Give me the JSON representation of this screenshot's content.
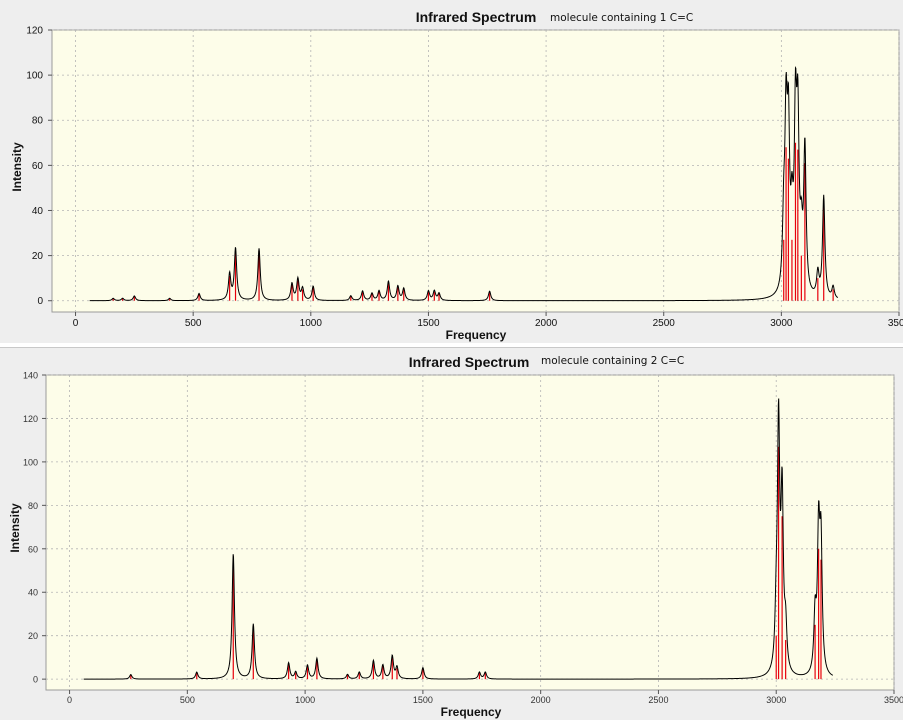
{
  "colors": {
    "plot_background": "#fdfde9",
    "spectrum_line": "#000000",
    "stick_color": "#e8000b",
    "grid_color": "#b4b4b4",
    "panel_background": "#eeeeee"
  },
  "chart_data": [
    {
      "type": "line",
      "title": "Infrared Spectrum",
      "subtitle": "molecule containing 1 C=C",
      "xlabel": "Frequency",
      "ylabel": "Intensity",
      "xlim": [
        -100,
        3500
      ],
      "ylim": [
        -5,
        120
      ],
      "x_ticks": [
        0,
        500,
        1000,
        1500,
        2000,
        2500,
        3000,
        3500
      ],
      "x_tick_labels": [
        "0",
        "500",
        "1000",
        "1500",
        "2000",
        "2500",
        "3000",
        "3500"
      ],
      "y_ticks": [
        0,
        20,
        40,
        60,
        80,
        100,
        120
      ],
      "y_tick_labels": [
        "0",
        "20",
        "40",
        "60",
        "80",
        "100",
        "120"
      ],
      "grid": true,
      "spectrum_range": [
        60,
        3240
      ],
      "peaks": [
        {
          "x": 160,
          "y": 1
        },
        {
          "x": 200,
          "y": 1
        },
        {
          "x": 250,
          "y": 2
        },
        {
          "x": 400,
          "y": 1
        },
        {
          "x": 525,
          "y": 3
        },
        {
          "x": 655,
          "y": 11
        },
        {
          "x": 680,
          "y": 22
        },
        {
          "x": 780,
          "y": 22
        },
        {
          "x": 920,
          "y": 7
        },
        {
          "x": 945,
          "y": 9
        },
        {
          "x": 965,
          "y": 5
        },
        {
          "x": 1010,
          "y": 6
        },
        {
          "x": 1170,
          "y": 2
        },
        {
          "x": 1220,
          "y": 4
        },
        {
          "x": 1260,
          "y": 3
        },
        {
          "x": 1290,
          "y": 4
        },
        {
          "x": 1330,
          "y": 8
        },
        {
          "x": 1370,
          "y": 6
        },
        {
          "x": 1395,
          "y": 5
        },
        {
          "x": 1500,
          "y": 4
        },
        {
          "x": 1525,
          "y": 4
        },
        {
          "x": 1545,
          "y": 3
        },
        {
          "x": 1760,
          "y": 4
        },
        {
          "x": 3010,
          "y": 27
        },
        {
          "x": 3020,
          "y": 68
        },
        {
          "x": 3030,
          "y": 63
        },
        {
          "x": 3045,
          "y": 27
        },
        {
          "x": 3060,
          "y": 70
        },
        {
          "x": 3070,
          "y": 67
        },
        {
          "x": 3085,
          "y": 20
        },
        {
          "x": 3100,
          "y": 61
        },
        {
          "x": 3155,
          "y": 10
        },
        {
          "x": 3180,
          "y": 43
        },
        {
          "x": 3220,
          "y": 5
        }
      ],
      "curve_width": 6
    },
    {
      "type": "line",
      "title": "Infrared Spectrum",
      "subtitle": "molecule containing 2 C=C",
      "xlabel": "Frequency",
      "ylabel": "Intensity",
      "xlim": [
        -100,
        3500
      ],
      "ylim": [
        -5,
        140
      ],
      "x_ticks": [
        0,
        500,
        1000,
        1500,
        2000,
        2500,
        3000,
        3500
      ],
      "x_tick_labels": [
        "0",
        "500",
        "1000",
        "1500",
        "2000",
        "2500",
        "3000",
        "3500"
      ],
      "y_ticks": [
        0,
        20,
        40,
        60,
        80,
        100,
        120,
        140
      ],
      "y_tick_labels": [
        "0",
        "20",
        "40",
        "60",
        "80",
        "100",
        "120",
        "140"
      ],
      "grid": true,
      "spectrum_range": [
        60,
        3240
      ],
      "peaks": [
        {
          "x": 260,
          "y": 2
        },
        {
          "x": 540,
          "y": 3
        },
        {
          "x": 695,
          "y": 55
        },
        {
          "x": 780,
          "y": 24
        },
        {
          "x": 930,
          "y": 7
        },
        {
          "x": 960,
          "y": 3
        },
        {
          "x": 1010,
          "y": 6
        },
        {
          "x": 1050,
          "y": 9
        },
        {
          "x": 1180,
          "y": 2
        },
        {
          "x": 1230,
          "y": 3
        },
        {
          "x": 1290,
          "y": 8
        },
        {
          "x": 1330,
          "y": 6
        },
        {
          "x": 1370,
          "y": 10
        },
        {
          "x": 1390,
          "y": 5
        },
        {
          "x": 1500,
          "y": 5
        },
        {
          "x": 1740,
          "y": 3
        },
        {
          "x": 1765,
          "y": 3
        },
        {
          "x": 3000,
          "y": 20
        },
        {
          "x": 3010,
          "y": 107
        },
        {
          "x": 3025,
          "y": 75
        },
        {
          "x": 3040,
          "y": 18
        },
        {
          "x": 3165,
          "y": 25
        },
        {
          "x": 3180,
          "y": 60
        },
        {
          "x": 3190,
          "y": 55
        }
      ],
      "curve_width": 6
    }
  ]
}
